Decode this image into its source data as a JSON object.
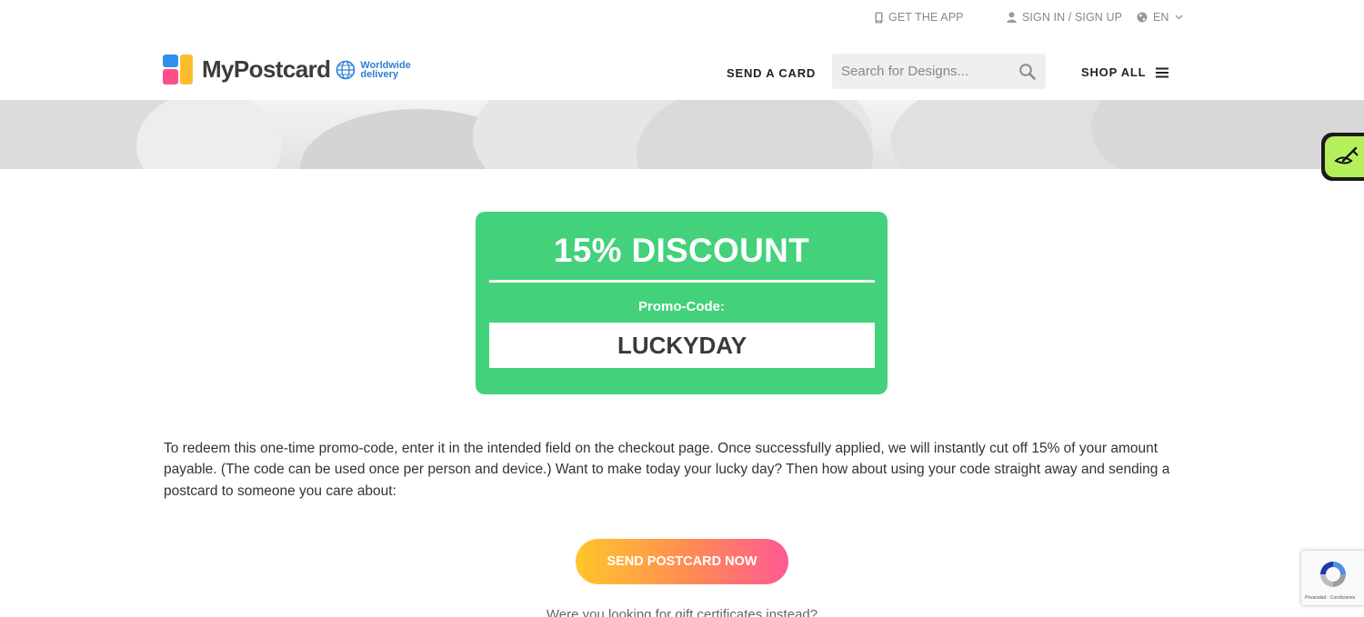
{
  "topbar": {
    "get_app": "GET THE APP",
    "sign_in": "SIGN IN / SIGN UP",
    "language": "EN"
  },
  "header": {
    "logo_text": "MyPostcard",
    "worldwide_line1": "Worldwide",
    "worldwide_line2": "delivery",
    "send_card": "SEND A CARD",
    "search_placeholder": "Search for Designs...",
    "shop_all": "SHOP ALL"
  },
  "promo": {
    "headline": "15% DISCOUNT",
    "label": "Promo-Code:",
    "code": "LUCKYDAY"
  },
  "description": "To redeem this one-time promo-code, enter it in the intended field on the checkout page. Once successfully applied, we will instantly cut off 15% of your amount payable. (The code can be used once per person and device.) Want to make today your lucky day? Then how about using your code straight away and sending a postcard to someone you care about:",
  "cta_label": "SEND POSTCARD NOW",
  "gift_text": "Were you looking for gift certificates instead?",
  "recaptcha_text": "Privacidad - Condiciones",
  "colors": {
    "promo_green": "#43d17b",
    "cta_gradient_start": "#ffc62a",
    "cta_gradient_end": "#ff5a92",
    "side_tab_green": "#b5f05c",
    "worldwide_blue": "#2c7fd4"
  },
  "icons": [
    "phone-icon",
    "user-icon",
    "globe-icon",
    "chevron-down-icon",
    "search-icon",
    "hamburger-icon",
    "pen-icon",
    "recaptcha-icon"
  ]
}
